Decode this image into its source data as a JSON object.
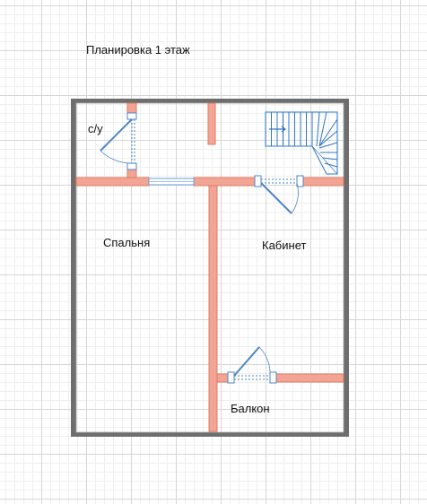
{
  "plan": {
    "title": "Планировка 1 этаж",
    "rooms": {
      "bathroom": "с/у",
      "bedroom": "Спальня",
      "office": "Кабинет",
      "balcony": "Балкон"
    }
  },
  "colors": {
    "outer_wall": "#6e6e6e",
    "inner_wall": "#f2a594",
    "inner_wall_outline": "#e07a60",
    "door": "#4f86c6",
    "stairs": "#2f78c4"
  }
}
